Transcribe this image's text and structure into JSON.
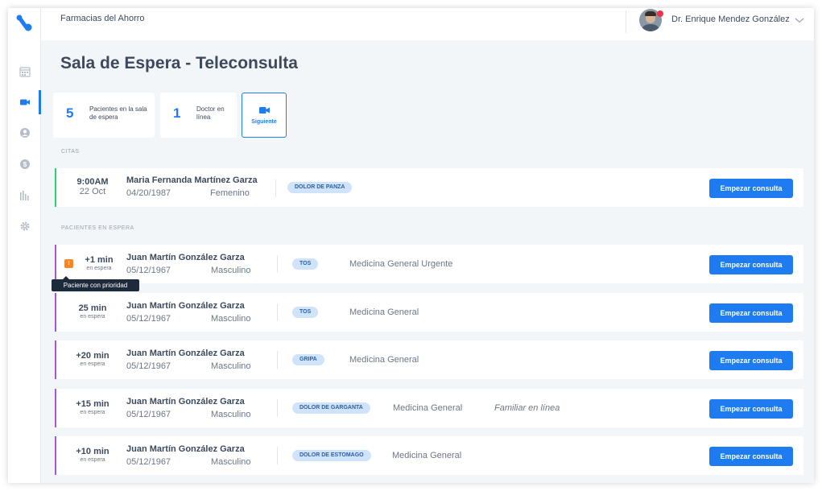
{
  "header": {
    "org_name": "Farmacias del Ahorro",
    "user_name": "Dr. Enrique Mendez González"
  },
  "sidebar": {
    "items": [
      {
        "icon": "calendar-icon"
      },
      {
        "icon": "video-camera-icon",
        "active": true
      },
      {
        "icon": "user-circle-icon"
      },
      {
        "icon": "money-icon"
      },
      {
        "icon": "bar-chart-icon"
      },
      {
        "icon": "gear-icon"
      }
    ]
  },
  "page": {
    "title": "Sala de Espera - Teleconsulta"
  },
  "stats": {
    "patients_count": "5",
    "patients_label": "Pacientes en la sala de espera",
    "doctors_count": "1",
    "doctors_label": "Doctor en línea",
    "next_label": "Siguiente"
  },
  "sections": {
    "appointments": "CITAS",
    "waiting": "PACIENTES EN ESPERA"
  },
  "appointment": {
    "time": "9:00AM",
    "date": "22 Oct",
    "name": "Maria Fernanda Martínez Garza",
    "dob": "04/20/1987",
    "sex": "Femenino",
    "tag": "DOLOR DE PANZA",
    "button": "Empezar consulta"
  },
  "waiting": [
    {
      "wait": "+1 min",
      "wait_sub": "en espera",
      "name": "Juan Martín González Garza",
      "dob": "05/12/1967",
      "sex": "Masculino",
      "tag": "TOS",
      "service": "Medicina General Urgente",
      "family": "",
      "button": "Empezar consulta",
      "priority": true
    },
    {
      "wait": "25 min",
      "wait_sub": "en espera",
      "name": "Juan Martín González Garza",
      "dob": "05/12/1967",
      "sex": "Masculino",
      "tag": "TOS",
      "service": "Medicina General",
      "family": "",
      "button": "Empezar consulta"
    },
    {
      "wait": "+20 min",
      "wait_sub": "en espera",
      "name": "Juan Martín González Garza",
      "dob": "05/12/1967",
      "sex": "Masculino",
      "tag": "GRIPA",
      "service": "Medicina General",
      "family": "",
      "button": "Empezar consulta"
    },
    {
      "wait": "+15 min",
      "wait_sub": "en espera",
      "name": "Juan Martín González Garza",
      "dob": "05/12/1967",
      "sex": "Masculino",
      "tag": "DOLOR DE GARGANTA",
      "service": "Medicina General",
      "family": "Familiar en línea",
      "button": "Empezar consulta"
    },
    {
      "wait": "+10 min",
      "wait_sub": "en espera",
      "name": "Juan Martín González Garza",
      "dob": "05/12/1967",
      "sex": "Masculino",
      "tag": "DOLOR DE ESTOMAGO",
      "service": "Medicina General",
      "family": "",
      "button": "Empezar consulta"
    }
  ],
  "priority_badge": "!",
  "tooltip": "Paciente con prioridad",
  "colors": {
    "primary": "#1f7cf0",
    "appointment_accent": "#2ecf72",
    "waiting_accent": "#a05ad8",
    "priority": "#f5872a",
    "tag_bg": "#cfe4fb"
  }
}
